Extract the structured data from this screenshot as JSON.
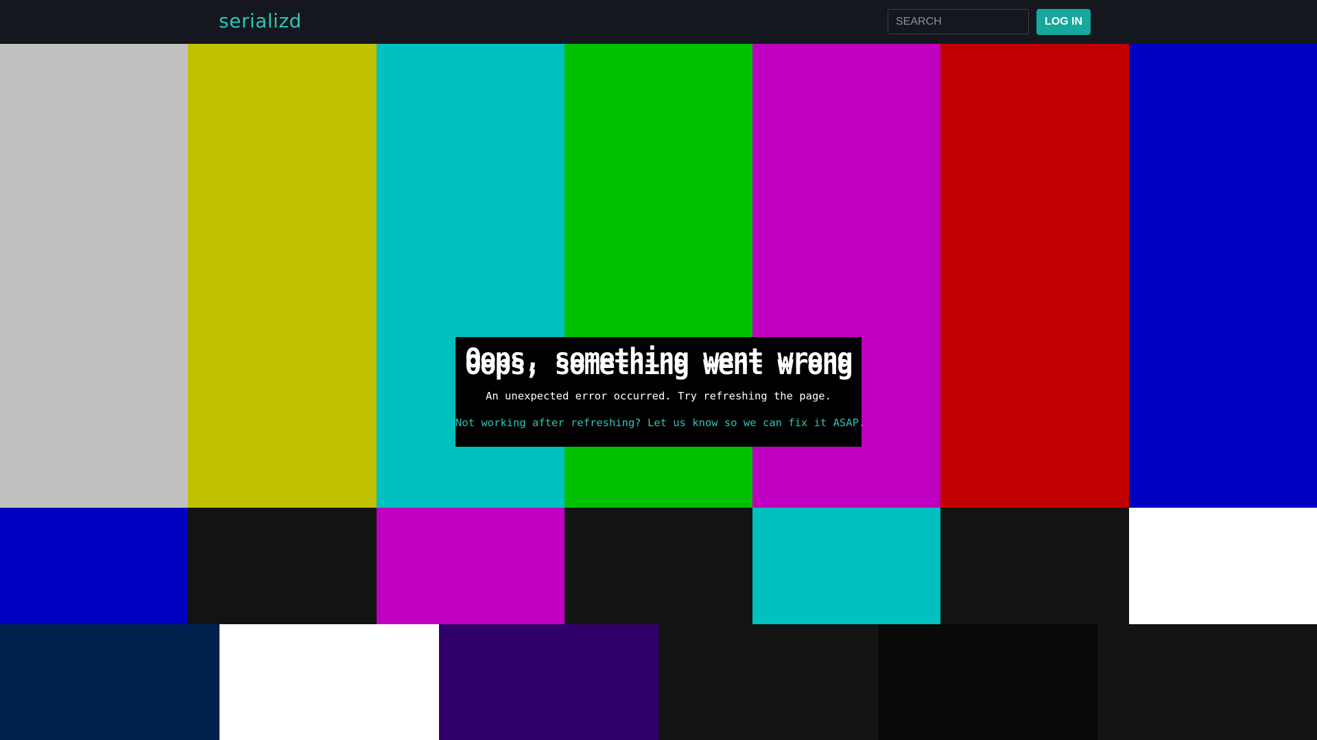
{
  "header": {
    "brand": "serializd",
    "search_placeholder": "SEARCH",
    "login_label": "LOG IN"
  },
  "error": {
    "title": "Oops, something went wrong",
    "message": "An unexpected error occurred. Try refreshing the page.",
    "link_text": "Not working after refreshing? Let us know so we can fix it ASAP."
  },
  "colors": {
    "accent": "#16a89c",
    "brand_text": "#2ec4b6",
    "navbar_bg": "#14181e",
    "top_bars": [
      "#c0c0c0",
      "#c0c000",
      "#00c0c0",
      "#00c000",
      "#c000c0",
      "#c00000",
      "#0000c0"
    ],
    "middle_bars": [
      "#0000c0",
      "#131313",
      "#c000c0",
      "#131313",
      "#00c0c0",
      "#131313",
      "#ffffff"
    ],
    "bottom_bars": [
      "#00214c",
      "#ffffff",
      "#32006a",
      "#131313",
      "#090909",
      "#131313"
    ]
  }
}
